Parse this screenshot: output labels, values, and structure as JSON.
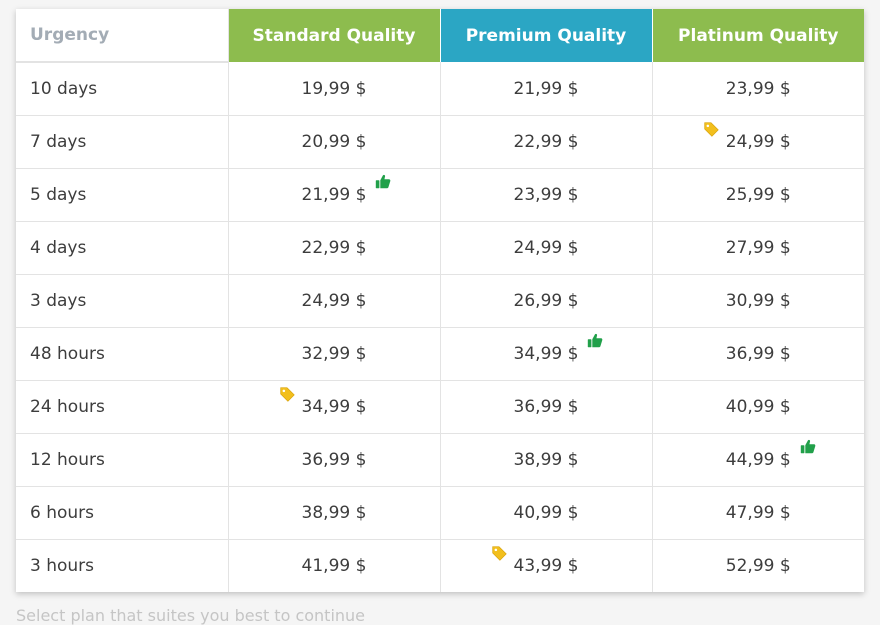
{
  "table": {
    "headers": [
      {
        "label": "Urgency",
        "key": "urgency"
      },
      {
        "label": "Standard Quality",
        "key": "standard",
        "color": "#8dbc4e"
      },
      {
        "label": "Premium Quality",
        "key": "premium",
        "color": "#2ba6c4"
      },
      {
        "label": "Platinum Quality",
        "key": "platinum",
        "color": "#8dbc4e"
      }
    ],
    "rows": [
      {
        "urgency": "10 days",
        "standard": "19,99 $",
        "premium": "21,99 $",
        "platinum": "23,99 $"
      },
      {
        "urgency": "7 days",
        "standard": "20,99 $",
        "premium": "22,99 $",
        "platinum": "24,99 $"
      },
      {
        "urgency": "5 days",
        "standard": "21,99 $",
        "premium": "23,99 $",
        "platinum": "25,99 $"
      },
      {
        "urgency": "4 days",
        "standard": "22,99 $",
        "premium": "24,99 $",
        "platinum": "27,99 $"
      },
      {
        "urgency": "3 days",
        "standard": "24,99 $",
        "premium": "26,99 $",
        "platinum": "30,99 $"
      },
      {
        "urgency": "48 hours",
        "standard": "32,99 $",
        "premium": "34,99 $",
        "platinum": "36,99 $"
      },
      {
        "urgency": "24 hours",
        "standard": "34,99 $",
        "premium": "36,99 $",
        "platinum": "40,99 $"
      },
      {
        "urgency": "12 hours",
        "standard": "36,99 $",
        "premium": "38,99 $",
        "platinum": "44,99 $"
      },
      {
        "urgency": "6 hours",
        "standard": "38,99 $",
        "premium": "40,99 $",
        "platinum": "47,99 $"
      },
      {
        "urgency": "3 hours",
        "standard": "41,99 $",
        "premium": "43,99 $",
        "platinum": "52,99 $"
      }
    ],
    "tag_cells": [
      {
        "row": 1,
        "col": "platinum",
        "icon": "price-tag-icon"
      },
      {
        "row": 6,
        "col": "standard",
        "icon": "price-tag-icon"
      },
      {
        "row": 9,
        "col": "premium",
        "icon": "price-tag-icon"
      }
    ],
    "thumb_cells": [
      {
        "row": 2,
        "col": "standard",
        "icon": "thumbs-up-icon"
      },
      {
        "row": 5,
        "col": "premium",
        "icon": "thumbs-up-icon"
      },
      {
        "row": 7,
        "col": "platinum",
        "icon": "thumbs-up-icon"
      }
    ]
  },
  "footer": {
    "hint": "Select plan that suites you best to continue"
  },
  "colors": {
    "green_header": "#8dbc4e",
    "blue_header": "#2ba6c4",
    "tag": "#f2bf1d",
    "thumb": "#21a04a"
  }
}
